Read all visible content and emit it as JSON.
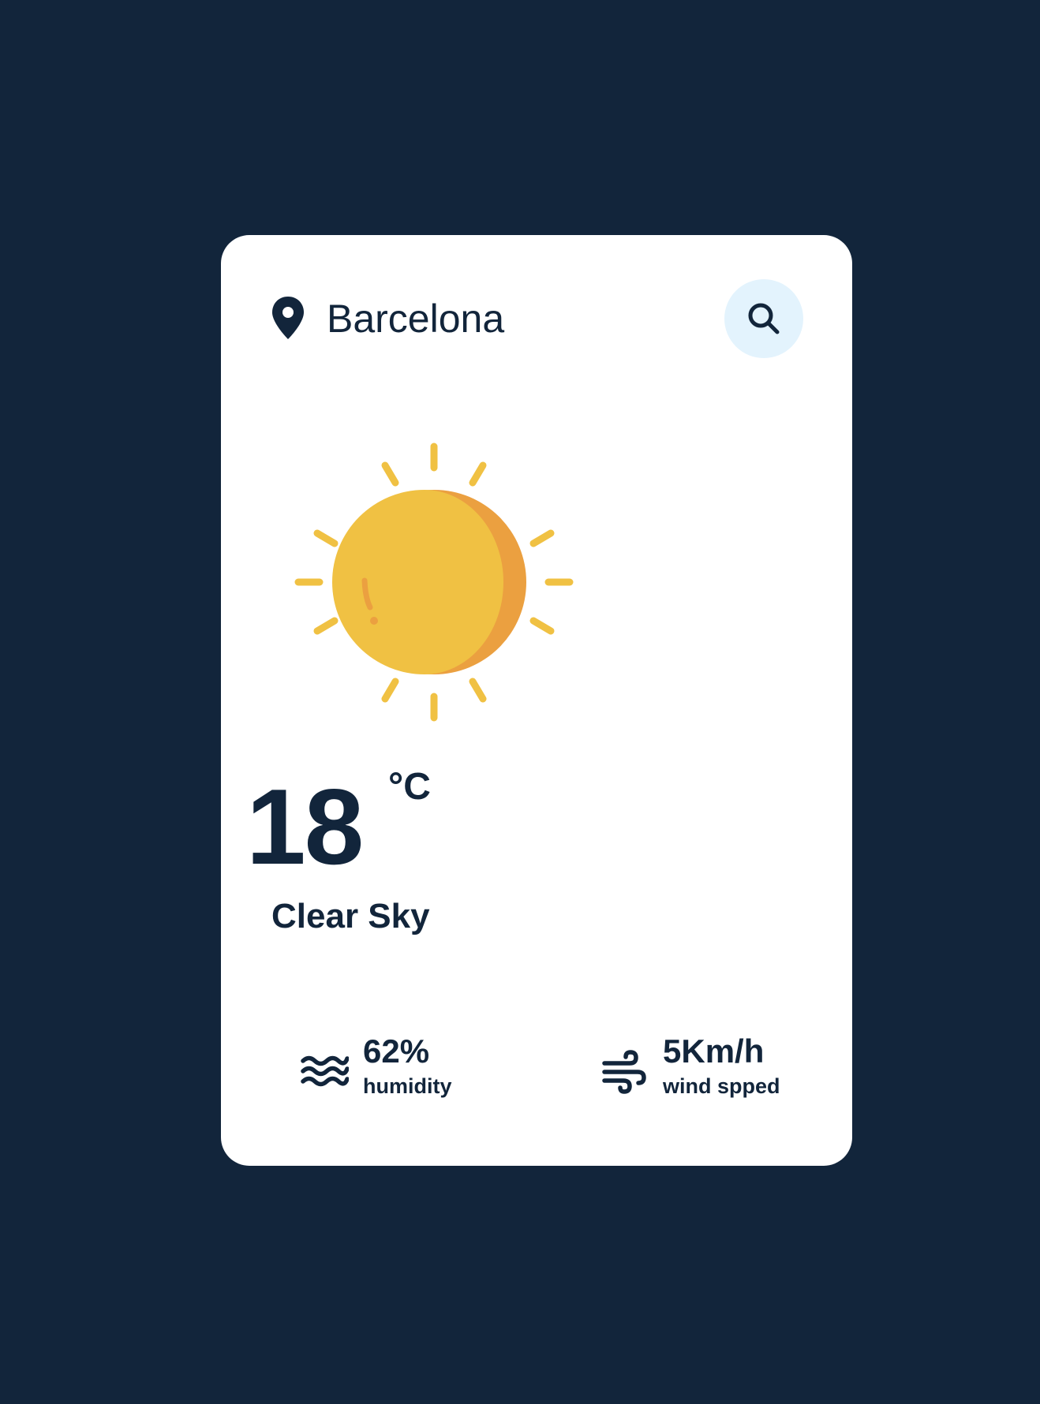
{
  "location": {
    "city": "Barcelona",
    "icon": "map-pin-icon"
  },
  "search": {
    "icon": "search-icon"
  },
  "weather": {
    "icon": "sun-icon",
    "temperature": "18",
    "unit": "°C",
    "condition": "Clear Sky"
  },
  "stats": {
    "humidity": {
      "value": "62%",
      "label": "humidity",
      "icon": "waves-icon"
    },
    "wind": {
      "value": "5Km/h",
      "label": "wind spped",
      "icon": "wind-icon"
    }
  },
  "colors": {
    "background": "#12253b",
    "card": "#ffffff",
    "text": "#12253b",
    "search_bg": "#e3f3fd",
    "sun": "#f0c143",
    "sun_shade": "#eba040"
  }
}
